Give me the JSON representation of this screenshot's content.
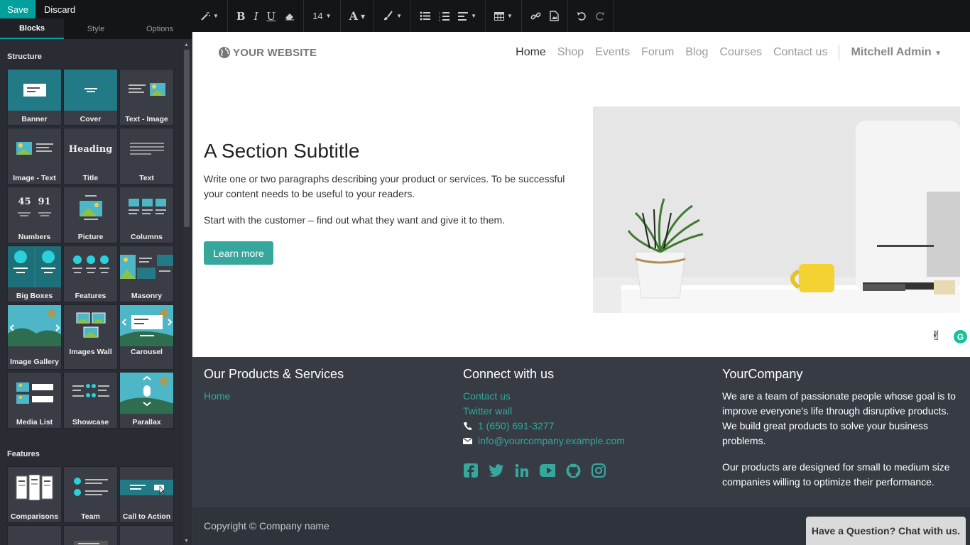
{
  "editor": {
    "save_label": "Save",
    "discard_label": "Discard",
    "tabs": [
      "Blocks",
      "Style",
      "Options"
    ],
    "active_tab": "Blocks",
    "sections": [
      {
        "title": "Structure",
        "blocks": [
          "Banner",
          "Cover",
          "Text - Image",
          "Image - Text",
          "Title",
          "Text",
          "Numbers",
          "Picture",
          "Columns",
          "Big Boxes",
          "Features",
          "Masonry",
          "Image Gallery",
          "Images Wall",
          "Carousel",
          "Media List",
          "Showcase",
          "Parallax"
        ]
      },
      {
        "title": "Features",
        "blocks": [
          "Comparisons",
          "Team",
          "Call to Action"
        ]
      }
    ],
    "thumb_text": {
      "heading": "Heading",
      "number_a": "45",
      "number_b": "91"
    }
  },
  "toolbar": {
    "font_size": "14",
    "font_color_glyph": "A"
  },
  "website": {
    "logo_text": "YOUR WEBSITE",
    "nav": [
      "Home",
      "Shop",
      "Events",
      "Forum",
      "Blog",
      "Courses",
      "Contact us"
    ],
    "active_nav": "Home",
    "user": "Mitchell Admin",
    "hero": {
      "title": "A Section Subtitle",
      "paragraph1": "Write one or two paragraphs describing your product or services. To be successful your content needs to be useful to your readers.",
      "paragraph2": "Start with the customer – find out what they want and give it to them.",
      "button": "Learn more"
    },
    "footer": {
      "col1_title": "Our Products & Services",
      "col1_links": [
        "Home"
      ],
      "col2_title": "Connect with us",
      "col2_links": [
        "Contact us",
        "Twitter wall"
      ],
      "phone": "1 (650) 691-3277",
      "email": "info@yourcompany.example.com",
      "col3_title": "YourCompany",
      "col3_p1": "We are a team of passionate people whose goal is to improve everyone's life through disruptive products. We build great products to solve your business problems.",
      "col3_p2": "Our products are designed for small to medium size companies willing to optimize their performance.",
      "copyright": "Copyright © Company name",
      "chat": "Have a Question? Chat with us."
    }
  },
  "colors": {
    "accent": "#35a79c",
    "sidebar_bg": "#292c33",
    "footer_bg": "#363b44"
  }
}
